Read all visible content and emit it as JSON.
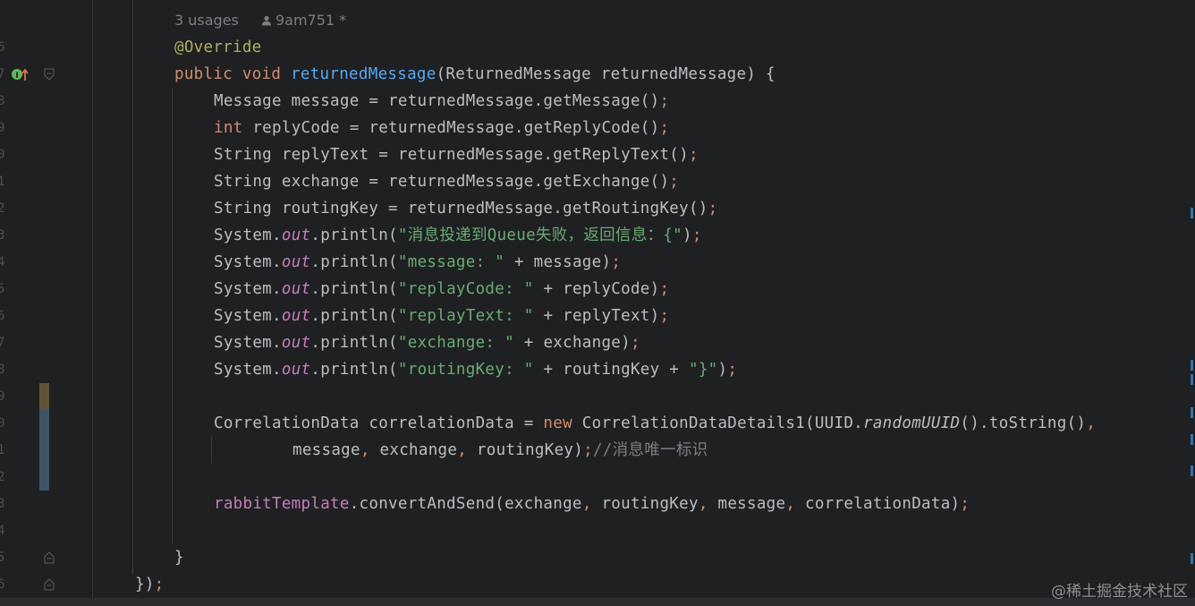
{
  "editor": {
    "inlay_hint": {
      "usages": "3 usages",
      "author": "9am751 *"
    },
    "line_numbers": [
      "6",
      "7",
      "8",
      "9",
      "0",
      "1",
      "2",
      "3",
      "4",
      "5",
      "6",
      "7",
      "8",
      "9",
      "0",
      "1",
      "2",
      "3",
      "4",
      "5",
      "6"
    ],
    "lines": {
      "l1": {
        "ann": "@Override"
      },
      "l2": {
        "kw1": "public",
        "kw2": "void",
        "fn": "returnedMessage",
        "rest": "(ReturnedMessage returnedMessage) {"
      },
      "l3": {
        "a": "Message message = returnedMessage.getMessage()",
        "semi": ";"
      },
      "l4": {
        "kw": "int",
        "a": " replyCode = returnedMessage.getReplyCode()",
        "semi": ";"
      },
      "l5": {
        "a": "String replyText = returnedMessage.getReplyText()",
        "semi": ";"
      },
      "l6": {
        "a": "String exchange = returnedMessage.getExchange()",
        "semi": ";"
      },
      "l7": {
        "a": "String routingKey = returnedMessage.getRoutingKey()",
        "semi": ";"
      },
      "l8": {
        "a": "System.",
        "out": "out",
        "b": ".println(",
        "str": "\"消息投递到Queue失败，返回信息：{\"",
        "c": ")",
        "semi": ";"
      },
      "l9": {
        "a": "System.",
        "out": "out",
        "b": ".println(",
        "str": "\"message: \"",
        "c": " + message)",
        "semi": ";"
      },
      "l10": {
        "a": "System.",
        "out": "out",
        "b": ".println(",
        "str": "\"replayCode: \"",
        "c": " + replyCode)",
        "semi": ";"
      },
      "l11": {
        "a": "System.",
        "out": "out",
        "b": ".println(",
        "str": "\"replayText: \"",
        "c": " + replyText)",
        "semi": ";"
      },
      "l12": {
        "a": "System.",
        "out": "out",
        "b": ".println(",
        "str": "\"exchange: \"",
        "c": " + exchange)",
        "semi": ";"
      },
      "l13": {
        "a": "System.",
        "out": "out",
        "b": ".println(",
        "str": "\"routingKey: \"",
        "c": " + routingKey + ",
        "str2": "\"}\"",
        "d": ")",
        "semi": ";"
      },
      "l15": {
        "a": "CorrelationData correlationData = ",
        "kw": "new",
        "b": " CorrelationDataDetails1(UUID.",
        "it": "randomUUID",
        "c": "().toString()",
        "comma": ","
      },
      "l16": {
        "a": "message",
        "c1": ",",
        "b": " exchange",
        "c2": ",",
        "c": " routingKey)",
        "semi": ";",
        "cmt": "//消息唯一标识"
      },
      "l18": {
        "fld": "rabbitTemplate",
        "a": ".convertAndSend(exchange",
        "c1": ",",
        "b": " routingKey",
        "c2": ",",
        "c": " message",
        "c3": ",",
        "d": " correlationData)",
        "semi": ";"
      },
      "l20": {
        "a": "}"
      },
      "l21": {
        "a": "})",
        "semi": ";"
      }
    },
    "icons": [
      "implements-up-icon",
      "fold-icon",
      "user-icon"
    ],
    "colors": {
      "background": "#1f2022",
      "keyword": "#cf8e6d",
      "function": "#56a8f5",
      "annotation": "#b3ae60",
      "string": "#6aab73",
      "field": "#c77dbb",
      "comment": "#7a7e85",
      "text": "#bcbec4"
    }
  },
  "watermark": "@稀土掘金技术社区"
}
